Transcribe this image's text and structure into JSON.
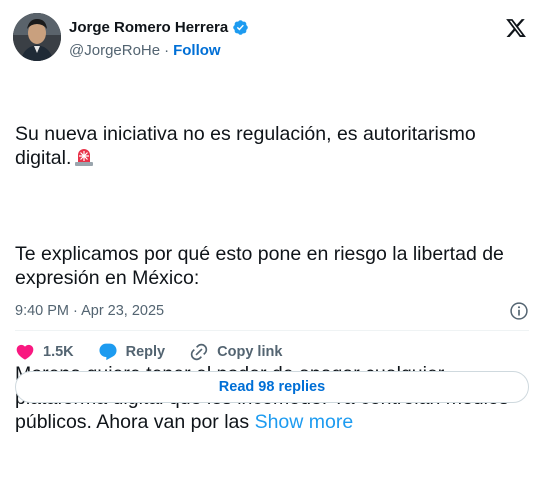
{
  "author": {
    "display_name": "Jorge Romero Herrera",
    "handle": "@JorgeRoHe",
    "separator": "·",
    "follow_label": "Follow"
  },
  "tweet": {
    "paragraphs": [
      "Su nueva iniciativa no es regulación, es autoritarismo digital.",
      "Te explicamos por qué esto pone en riesgo la libertad de expresión en México:",
      "Morena quiere tener el poder de apagar cualquier plataforma digital que les incomode. Ya controlan medios públicos. Ahora van por las "
    ],
    "emoji": "rotating-light-emoji",
    "show_more_label": "Show more",
    "timestamp": "9:40 PM · Apr 23, 2025"
  },
  "actions": {
    "like_count": "1.5K",
    "reply_label": "Reply",
    "copy_link_label": "Copy link"
  },
  "replies_button": {
    "label": "Read 98 replies"
  },
  "colors": {
    "text": "#0f1419",
    "secondary": "#536471",
    "link": "#1d9bf0",
    "follow": "#006fd6",
    "like": "#f91880",
    "verified": "#1d9bf0",
    "reply_icon": "#1d9bf0"
  },
  "icons": {
    "verified": "verified-badge-icon",
    "logo": "x-logo-icon",
    "info": "info-icon",
    "like": "heart-icon",
    "reply": "reply-bubble-icon",
    "copy_link": "link-icon"
  }
}
